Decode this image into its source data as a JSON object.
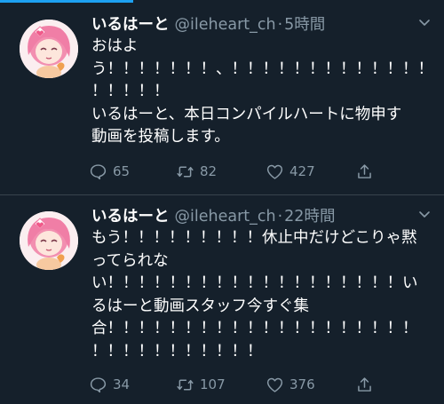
{
  "tweets": [
    {
      "display_name": "いるはーと",
      "handle": "@ileheart_ch",
      "separator": "·",
      "time": "5時間",
      "lines": [
        "おはよ",
        "う！！！！！！！、！！！！！！！！！！！！！",
        "！！！！！",
        "いるはーと、本日コンパイルハートに物申す",
        "動画を投稿します。"
      ],
      "replies": "65",
      "retweets": "82",
      "likes": "427"
    },
    {
      "display_name": "いるはーと",
      "handle": "@ileheart_ch",
      "separator": "·",
      "time": "22時間",
      "lines": [
        "もう！！！！！！！！！休止中だけどこりゃ黙",
        "ってられな",
        "い！！！！！！！！！！！！！！！！！！！い",
        "るはーと動画スタッフ今すぐ集",
        "合！！！！！！！！！！！！！！！！！！！！",
        "！！！！！！！！！！！"
      ],
      "replies": "34",
      "retweets": "107",
      "likes": "376"
    }
  ],
  "icons": {
    "more": "chevron-down-icon",
    "reply": "reply-icon",
    "retweet": "retweet-icon",
    "like": "heart-icon",
    "share": "share-icon"
  },
  "colors": {
    "background": "#15202b",
    "text": "#ffffff",
    "secondary": "#8899a6",
    "divider": "#38444d",
    "accent": "#1da1f2"
  }
}
